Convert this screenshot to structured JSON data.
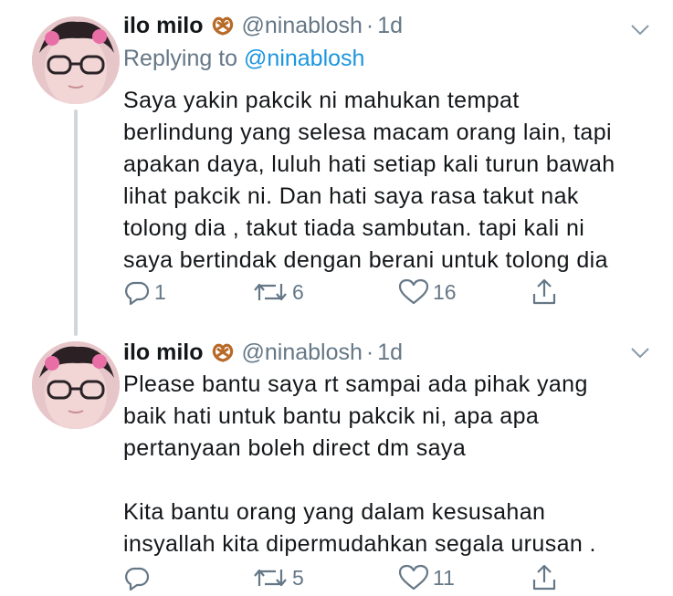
{
  "tweets": [
    {
      "author_name": "ilo milo",
      "author_emoji": "pretzel-icon",
      "handle": "@ninablosh",
      "separator": "·",
      "time": "1d",
      "replying_prefix": "Replying to",
      "replying_to": "@ninablosh",
      "text_lines": [
        "Saya yakin pakcik ni mahukan tempat",
        "berlindung yang selesa macam orang lain, tapi",
        "apakan daya, luluh hati setiap kali turun bawah",
        "lihat pakcik ni. Dan hati saya  rasa takut nak",
        "tolong dia , takut tiada sambutan. tapi kali ni",
        "saya bertindak dengan berani untuk tolong dia"
      ],
      "reply_count": "1",
      "retweet_count": "6",
      "like_count": "16"
    },
    {
      "author_name": "ilo milo",
      "author_emoji": "pretzel-icon",
      "handle": "@ninablosh",
      "separator": "·",
      "time": "1d",
      "text_lines": [
        "Please bantu saya rt sampai ada pihak yang",
        "baik hati untuk bantu pakcik ni, apa apa",
        "pertanyaan boleh direct dm saya",
        "",
        "Kita bantu orang yang dalam kesusahan",
        "insyallah kita dipermudahkan segala urusan ."
      ],
      "reply_count": "",
      "retweet_count": "5",
      "like_count": "11"
    }
  ],
  "colors": {
    "text": "#14171a",
    "secondary": "#657786",
    "link": "#1b95e0",
    "thread_line": "#cfd6dc"
  }
}
